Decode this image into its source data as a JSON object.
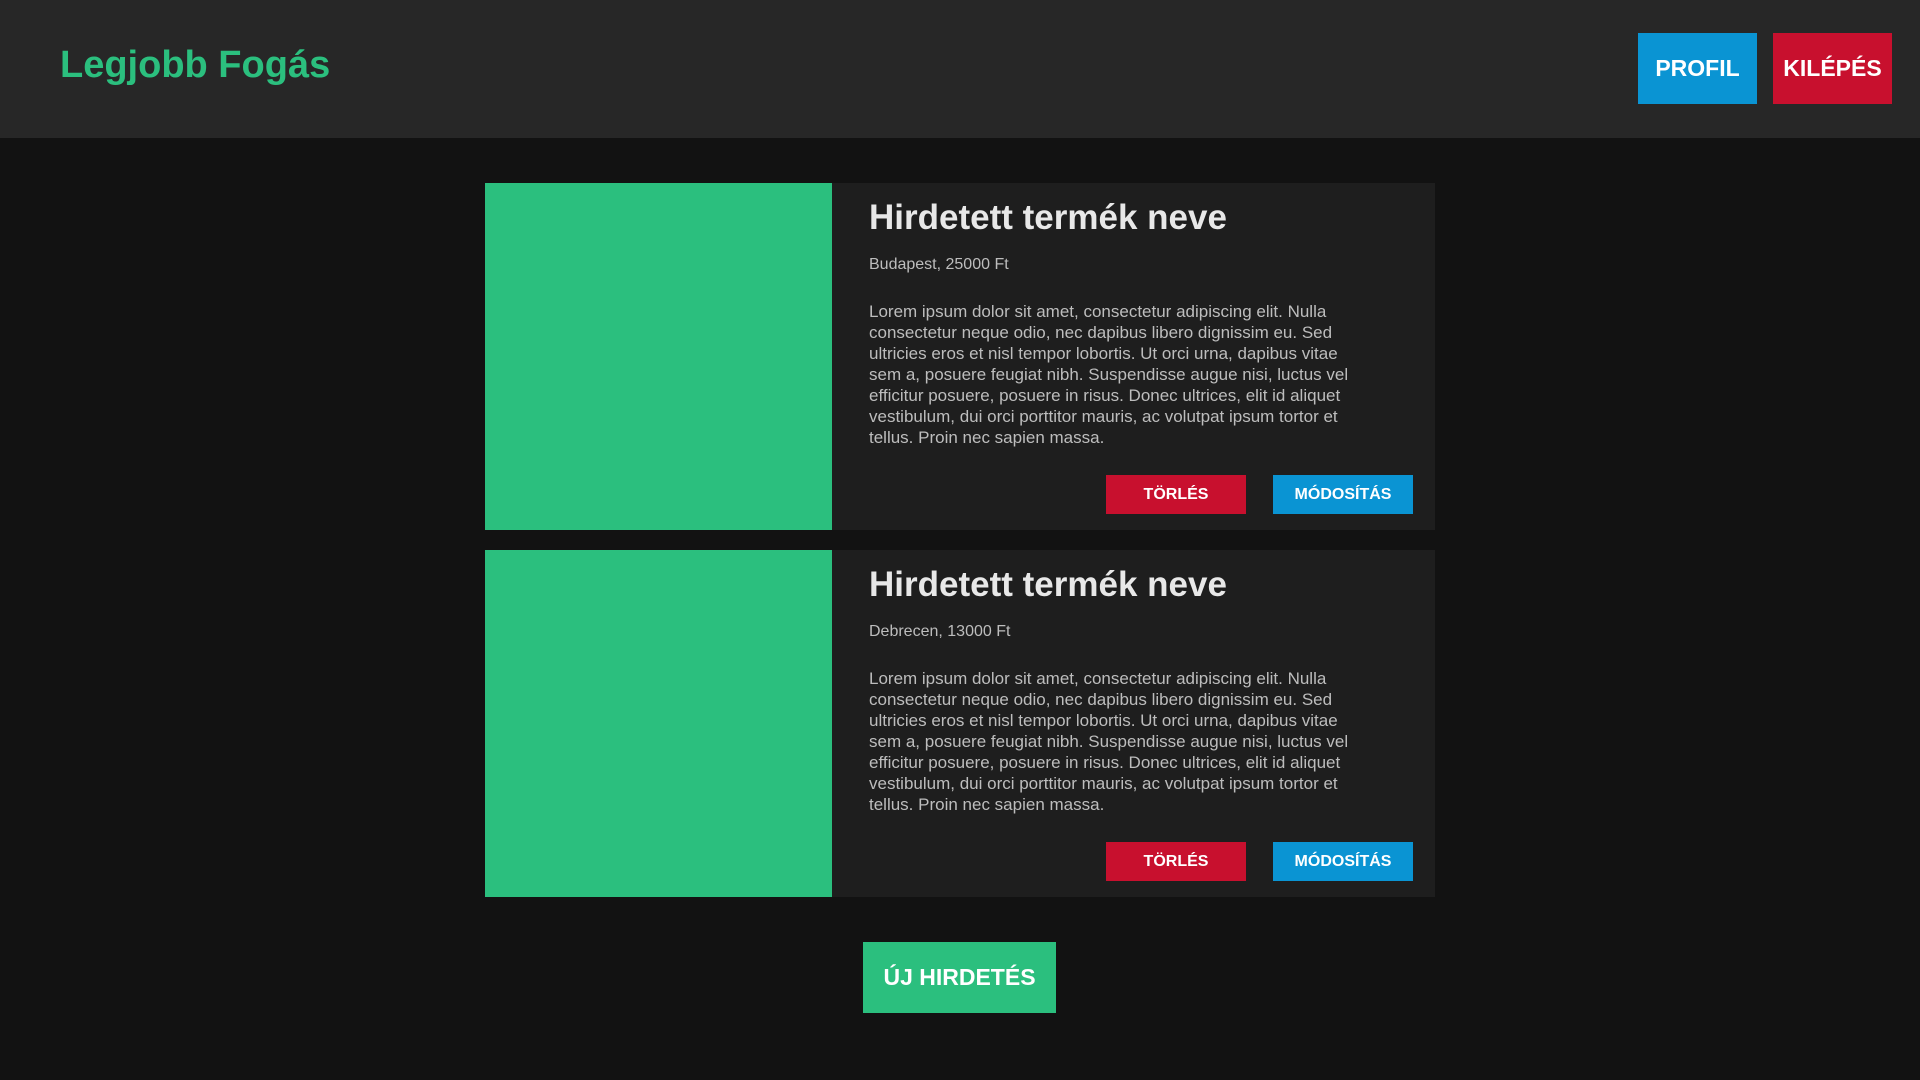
{
  "header": {
    "logo": "Legjobb Fogás",
    "profile_label": "PROFIL",
    "logout_label": "KILÉPÉS"
  },
  "listings": [
    {
      "title": "Hirdetett termék neve",
      "meta": "Budapest, 25000 Ft",
      "description": "Lorem ipsum dolor sit amet, consectetur adipiscing elit. Nulla consectetur neque odio, nec dapibus libero dignissim eu. Sed ultricies eros et nisl tempor lobortis. Ut orci urna, dapibus vitae sem a, posuere feugiat nibh. Suspendisse augue nisi, luctus vel efficitur posuere, posuere in risus. Donec ultrices, elit id aliquet vestibulum, dui orci porttitor mauris, ac volutpat ipsum tortor et tellus. Proin nec sapien massa.",
      "delete_label": "TÖRLÉS",
      "edit_label": "MÓDOSÍTÁS"
    },
    {
      "title": "Hirdetett termék neve",
      "meta": "Debrecen, 13000 Ft",
      "description": "Lorem ipsum dolor sit amet, consectetur adipiscing elit. Nulla consectetur neque odio, nec dapibus libero dignissim eu. Sed ultricies eros et nisl tempor lobortis. Ut orci urna, dapibus vitae sem a, posuere feugiat nibh. Suspendisse augue nisi, luctus vel efficitur posuere, posuere in risus. Donec ultrices, elit id aliquet vestibulum, dui orci porttitor mauris, ac volutpat ipsum tortor et tellus. Proin nec sapien massa.",
      "delete_label": "TÖRLÉS",
      "edit_label": "MÓDOSÍTÁS"
    }
  ],
  "new_listing_label": "ÚJ HIRDETÉS",
  "colors": {
    "accent_green": "#2bbf7e",
    "blue": "#0a94d3",
    "red": "#c8102e",
    "background": "#121212",
    "header_bg": "#272727",
    "card_bg": "#1e1e1e"
  }
}
